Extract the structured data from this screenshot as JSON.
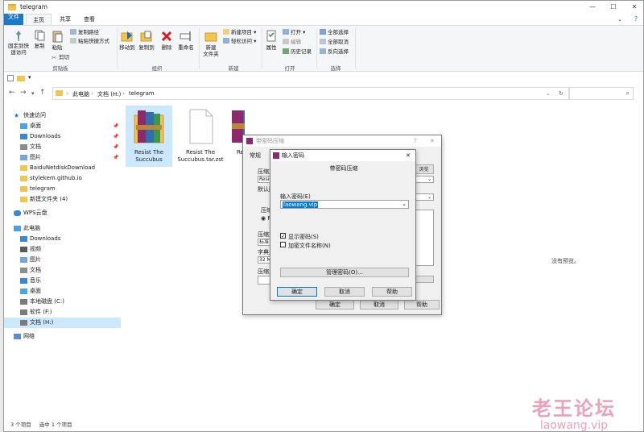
{
  "window": {
    "title": "telegram"
  },
  "tabs": {
    "file": "文件",
    "home": "主页",
    "share": "共享",
    "view": "查看"
  },
  "ribbon": {
    "pin": "固定到快\n速访问",
    "copy": "复制",
    "paste": "粘贴",
    "copy_path": "复制路径",
    "paste_shortcut": "粘贴快捷方式",
    "cut": "剪切",
    "clipboard_group": "剪贴板",
    "move_to": "移动到",
    "copy_to": "复制到",
    "delete": "删除",
    "rename": "重命名",
    "organize_group": "组织",
    "new_folder": "新建\n文件夹",
    "new_item": "新建项目",
    "easy_access": "轻松访问",
    "new_group": "新建",
    "properties": "属性",
    "open": "打开",
    "edit": "编辑",
    "history": "历史记录",
    "open_group": "打开",
    "select_all": "全部选择",
    "select_none": "全部取消",
    "invert_select": "反向选择",
    "select_group": "选择"
  },
  "address": {
    "this_pc": "此电脑",
    "drive": "文档 (H:)",
    "folder": "telegram"
  },
  "sidebar": {
    "quick_access": "快速访问",
    "items": [
      "桌面",
      "Downloads",
      "文档",
      "图片",
      "BaiduNetdiskDownload",
      "stylekem.github.io",
      "telegram",
      "新建文件夹 (4)"
    ],
    "wps": "WPS云盘",
    "this_pc": "此电脑",
    "pc_items": [
      "Downloads",
      "视频",
      "图片",
      "文档",
      "音乐",
      "桌面",
      "本地磁盘 (C:)",
      "软件 (F:)",
      "文档 (H:)"
    ],
    "network": "网络"
  },
  "files": [
    {
      "name": "Resist The Succubus"
    },
    {
      "name": "Resist The Succubus.tar.zst"
    },
    {
      "name": "Re Succ"
    }
  ],
  "preview_text": "没有预览。",
  "status": {
    "count": "3 个项目",
    "selected": "选中 1 个项目"
  },
  "archive_dialog": {
    "title": "带密码压缩",
    "help": "?",
    "tab_general": "常规",
    "label_file": "压缩文",
    "file_value": "Resis",
    "label_profile": "默认配",
    "label_format": "压缩",
    "format_value": "RA",
    "label_method": "压缩方",
    "method_value": "标准",
    "label_dict": "字典大",
    "dict_value": "32 MB",
    "label_split": "压缩为",
    "browse": "浏览(B)...",
    "ok": "确定",
    "cancel": "取消",
    "help_btn": "帮助"
  },
  "password_dialog": {
    "title": "输入密码",
    "header": "带密码压缩",
    "label": "输入密码(E)",
    "password": "laowang.vip",
    "show_password": "显示密码(S)",
    "encrypt_names": "加密文件名称(N)",
    "manage": "管理密码(O)...",
    "ok": "确定",
    "cancel": "取消",
    "help": "帮助"
  },
  "watermark": {
    "cn": "老王论坛",
    "en": "laowang.vip"
  }
}
